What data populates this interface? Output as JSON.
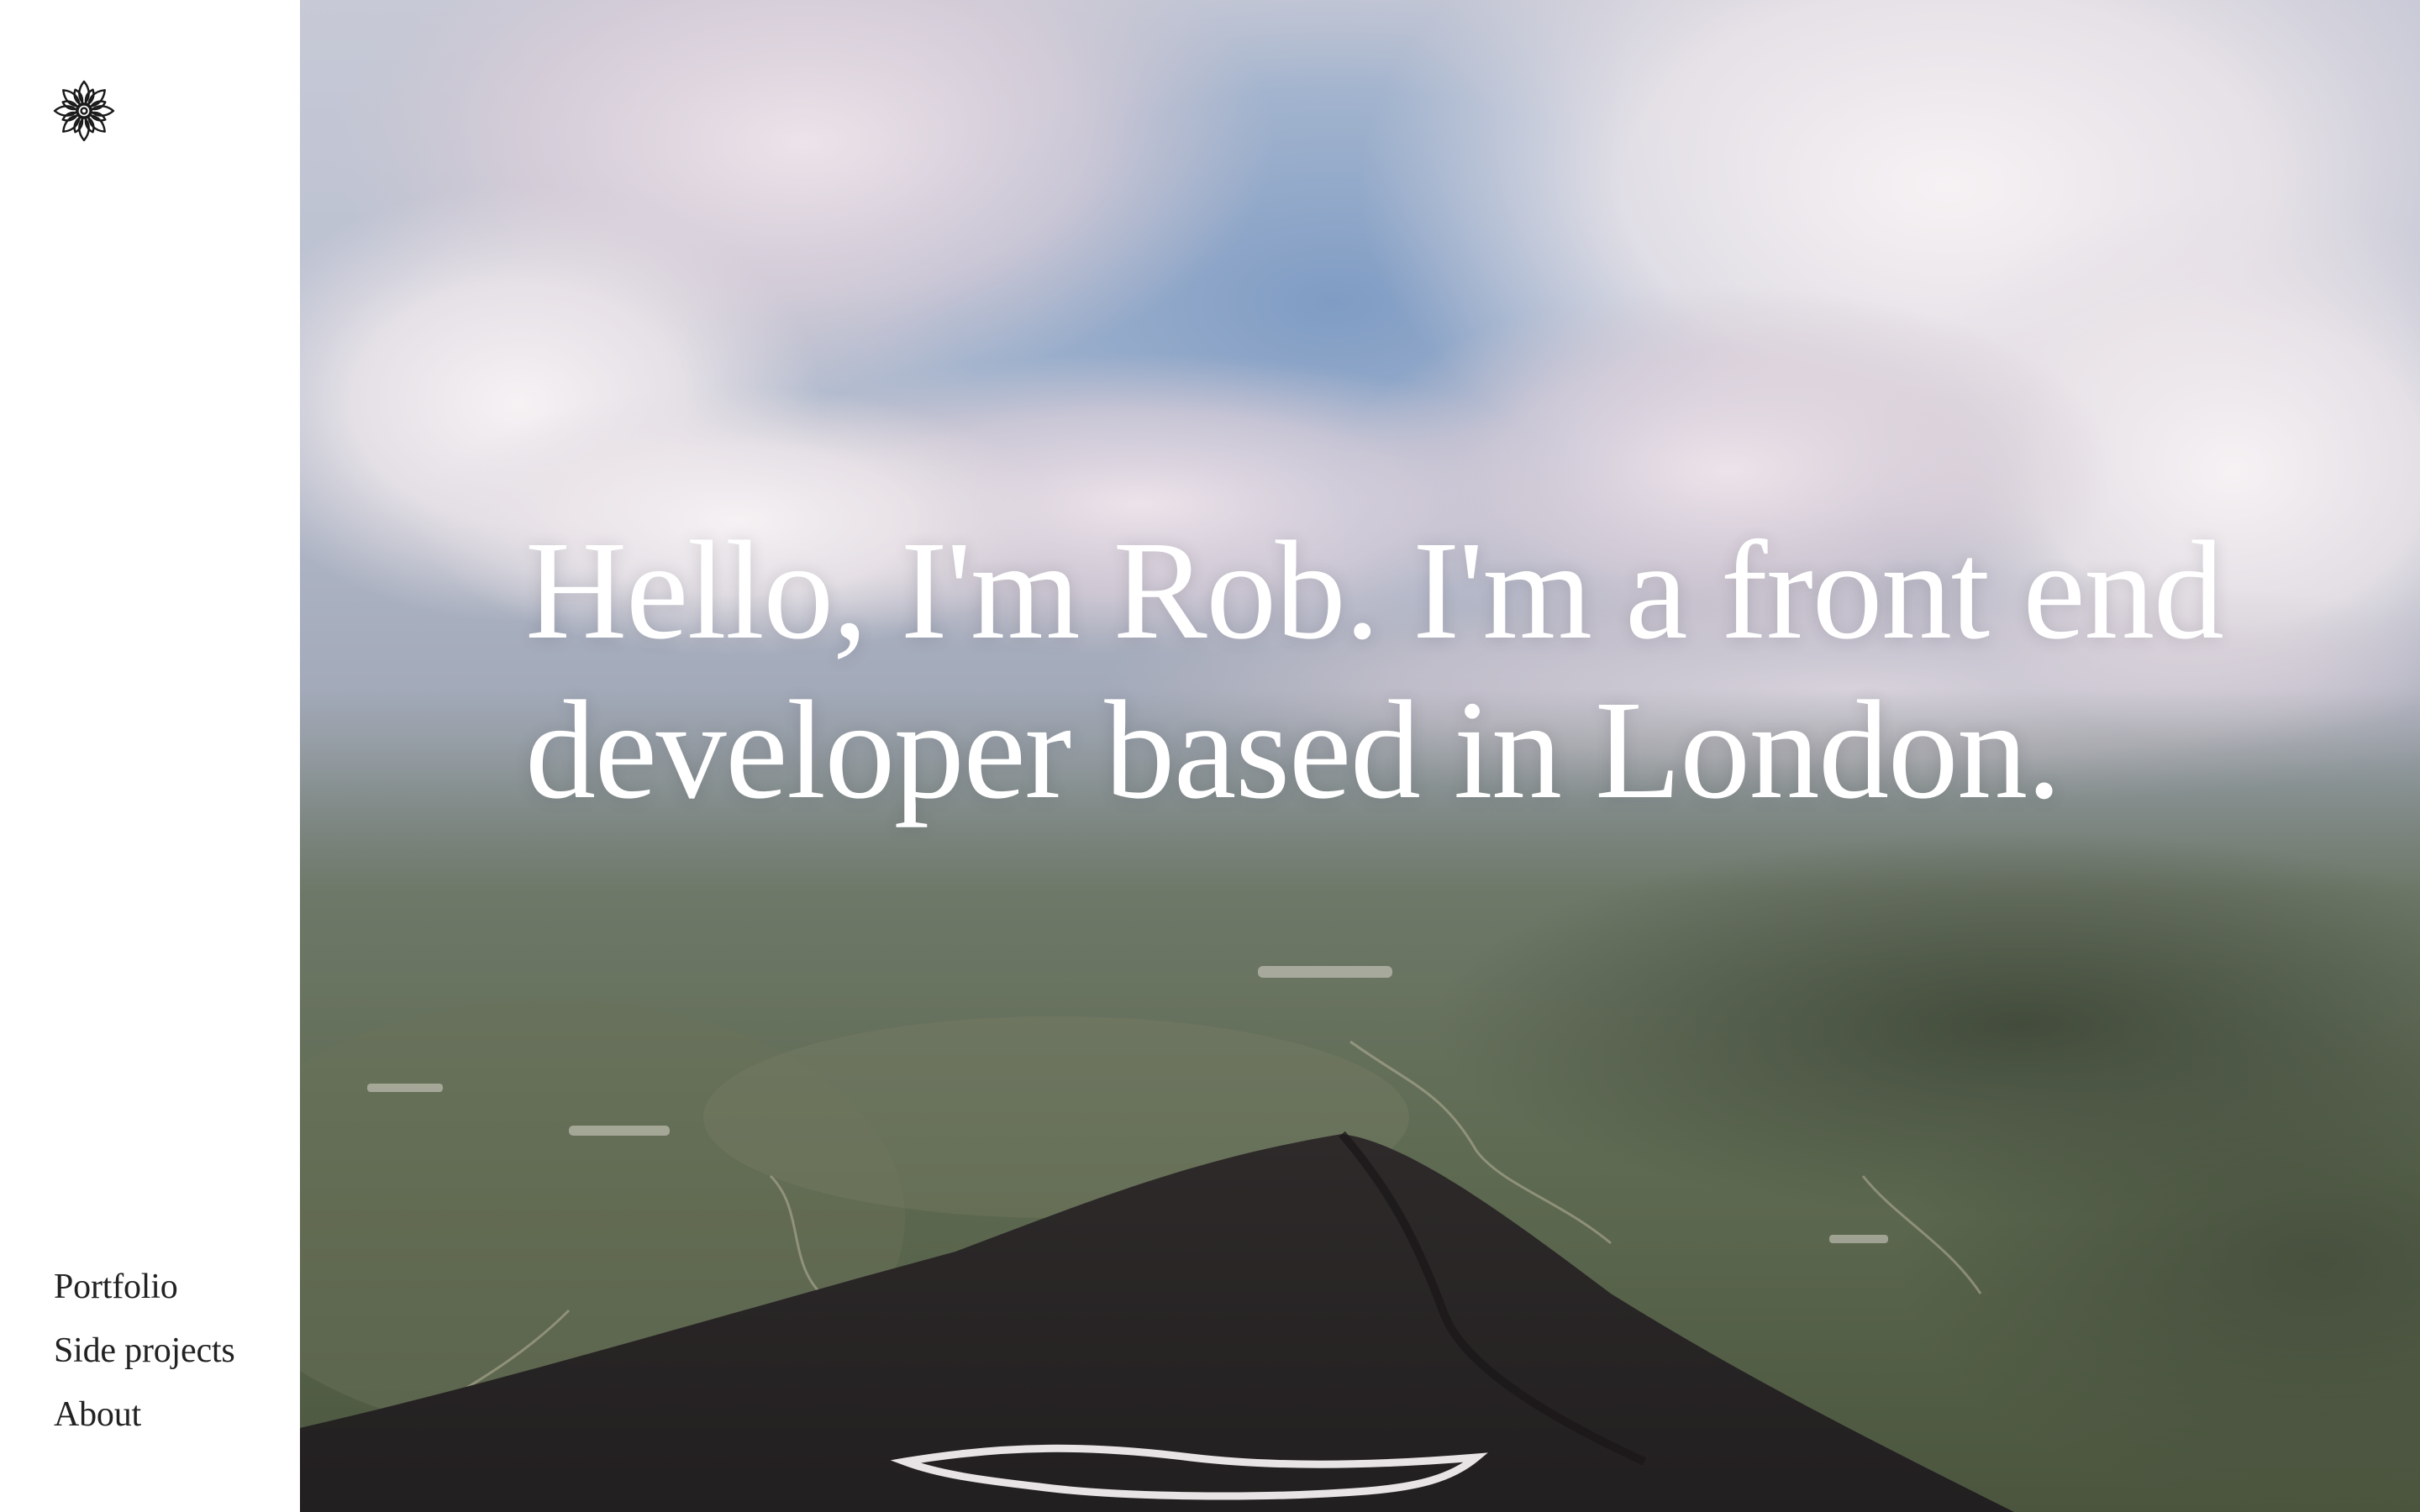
{
  "site": {
    "logo_icon": "lotus-mandala-icon"
  },
  "nav": {
    "items": [
      {
        "label": "Portfolio"
      },
      {
        "label": "Side projects"
      },
      {
        "label": "About"
      }
    ]
  },
  "hero": {
    "headline": "Hello, I'm Rob. I'm a front end developer based in London.",
    "text_color": "#ffffff",
    "sidebar_bg": "#ffffff",
    "nav_color": "#222222"
  }
}
